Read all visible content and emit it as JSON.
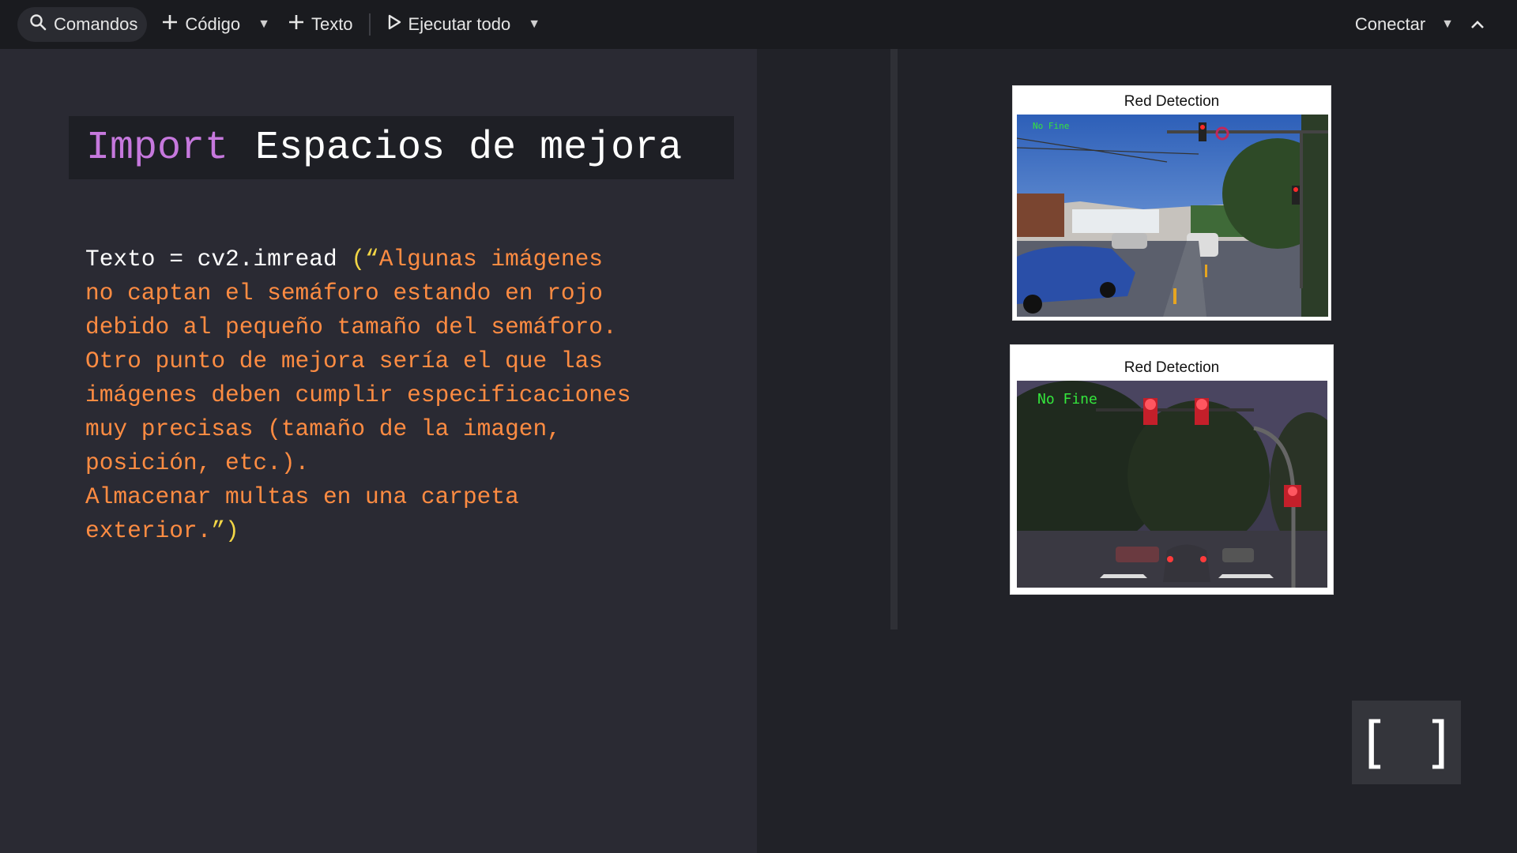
{
  "toolbar": {
    "search_label": "Comandos",
    "code_label": "Código",
    "text_label": "Texto",
    "run_all_label": "Ejecutar todo",
    "connect_label": "Conectar"
  },
  "cell": {
    "title_keyword": "Import",
    "title_text": "Espacios de mejora",
    "code_prefix": "Texto = cv2.imread ",
    "code_open": "(“",
    "code_lines": [
      "Algunas imágenes",
      "no captan el semáforo estando en rojo",
      "debido al pequeño tamaño del semáforo.",
      "Otro punto de mejora sería el que las",
      "imágenes deben cumplir especificaciones",
      "muy precisas (tamaño de la imagen,",
      "posición, etc.).",
      "Almacenar multas en una carpeta",
      "exterior."
    ],
    "code_close": "”)"
  },
  "figures": [
    {
      "title": "Red Detection",
      "overlay": "No Fine"
    },
    {
      "title": "Red Detection",
      "overlay": "No Fine"
    }
  ],
  "expand_button": {
    "label": "[ ]"
  },
  "colors": {
    "keyword": "#c678dd",
    "string": "#ff8c42",
    "paren": "#f2d646",
    "overlay_text": "#34e53c"
  }
}
